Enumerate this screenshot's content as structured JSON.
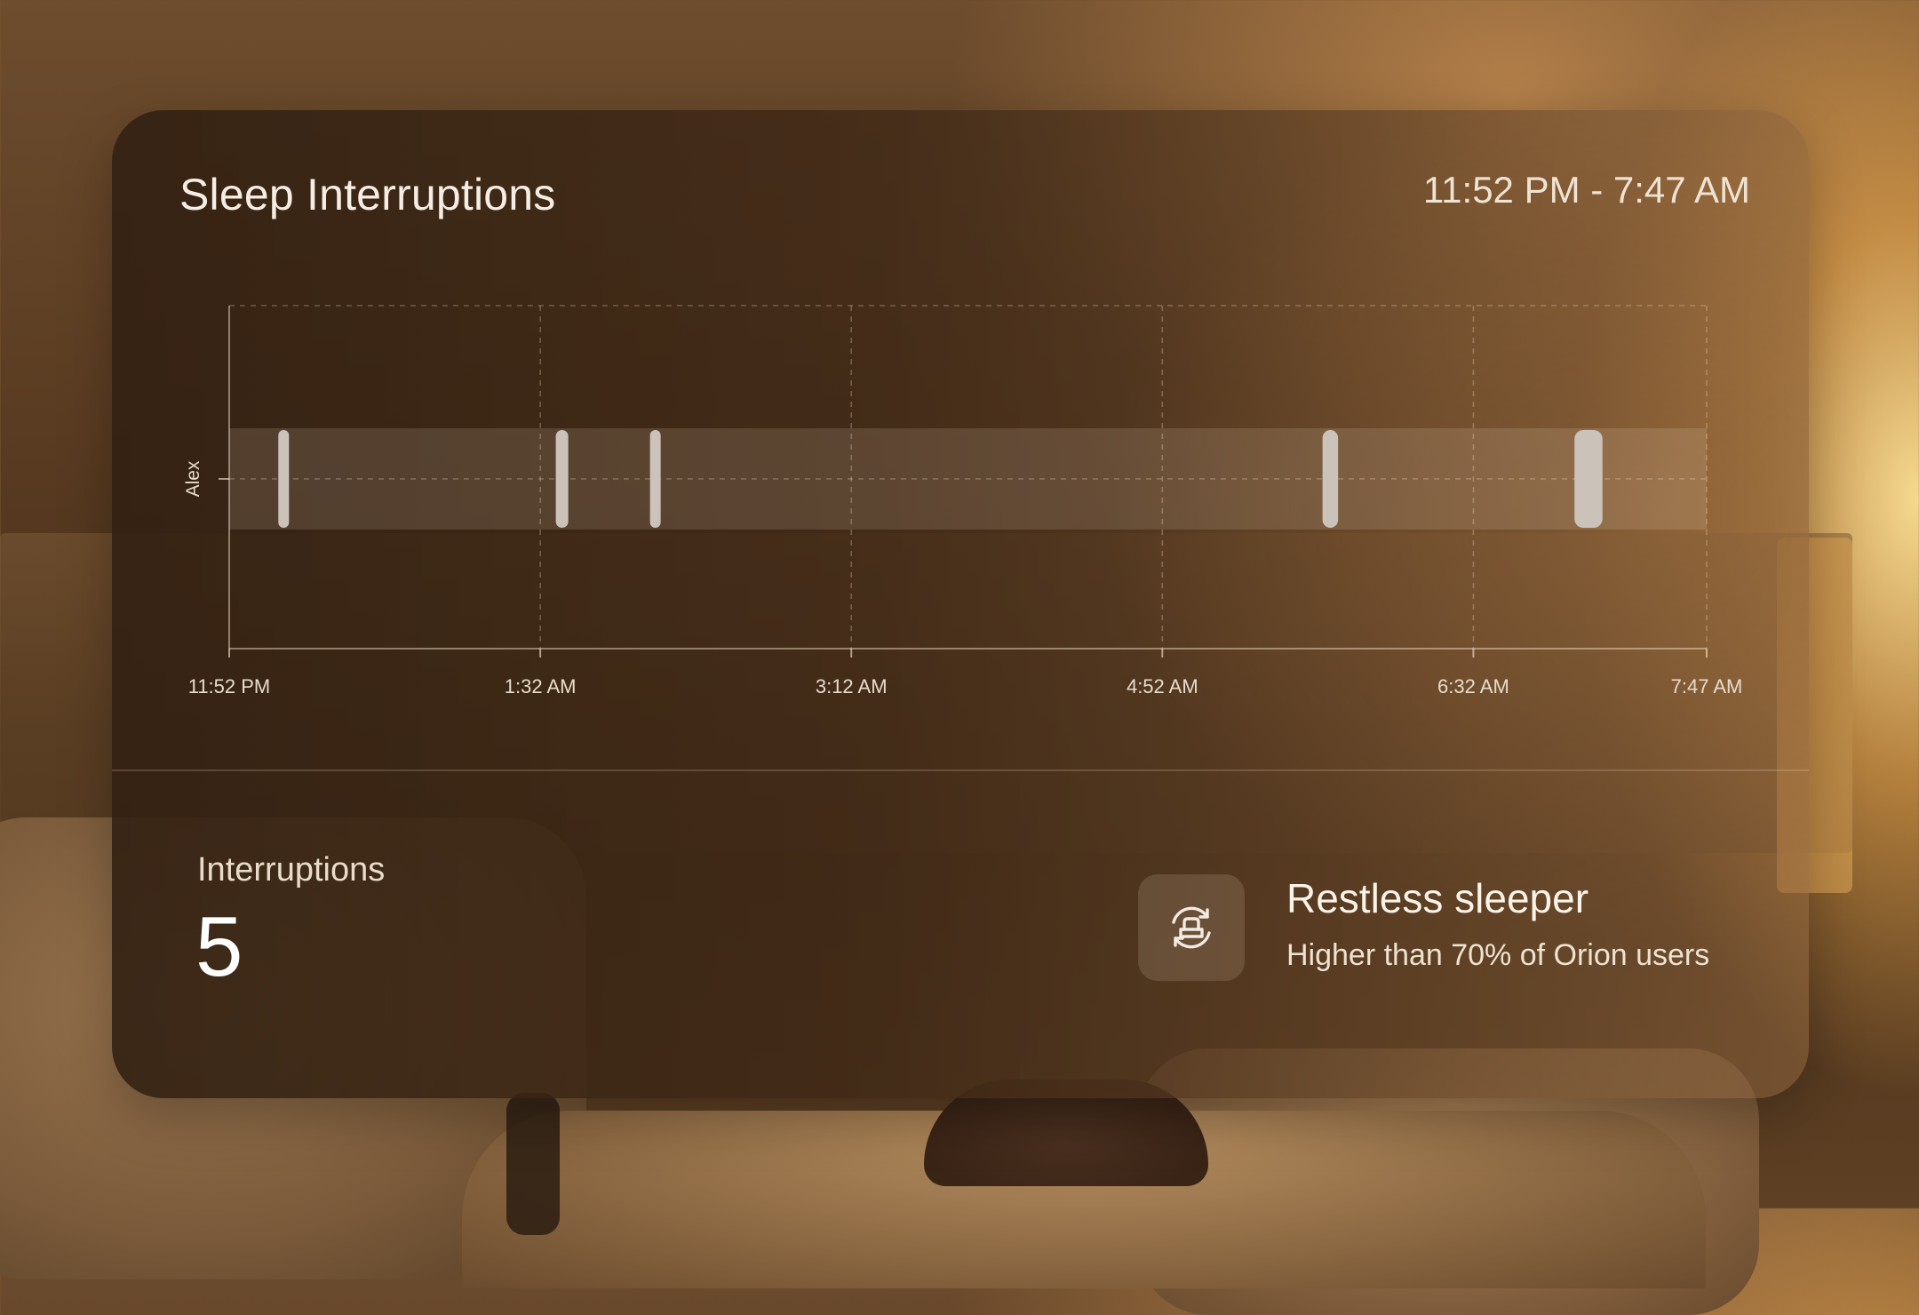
{
  "card": {
    "title": "Sleep Interruptions",
    "time_range": "11:52 PM - 7:47 AM"
  },
  "chart_data": {
    "type": "scatter",
    "title": "Sleep Interruptions",
    "row_label": "Alex",
    "x_ticks": [
      "11:52 PM",
      "1:32 AM",
      "3:12 AM",
      "4:52 AM",
      "6:32 AM",
      "7:47 AM"
    ],
    "x_tick_minutes": [
      0,
      100,
      200,
      300,
      400,
      475
    ],
    "x_range_minutes": [
      0,
      475
    ],
    "interruptions": [
      {
        "start_min": 17.5,
        "duration_min": 3
      },
      {
        "start_min": 107,
        "duration_min": 4
      },
      {
        "start_min": 137,
        "duration_min": 2.5
      },
      {
        "start_min": 354,
        "duration_min": 5
      },
      {
        "start_min": 437,
        "duration_min": 9
      }
    ],
    "grid": true
  },
  "stats": {
    "interruptions_label": "Interruptions",
    "interruptions_value": "5"
  },
  "badge": {
    "icon": "restless-sleep-icon",
    "title": "Restless sleeper",
    "subtitle": "Higher than 70% of Orion users"
  },
  "colors": {
    "marker": "#cbc3ba",
    "band": "rgba(255,235,210,0.14)",
    "grid": "rgba(255,235,210,0.28)",
    "text": "#f6eee4"
  }
}
